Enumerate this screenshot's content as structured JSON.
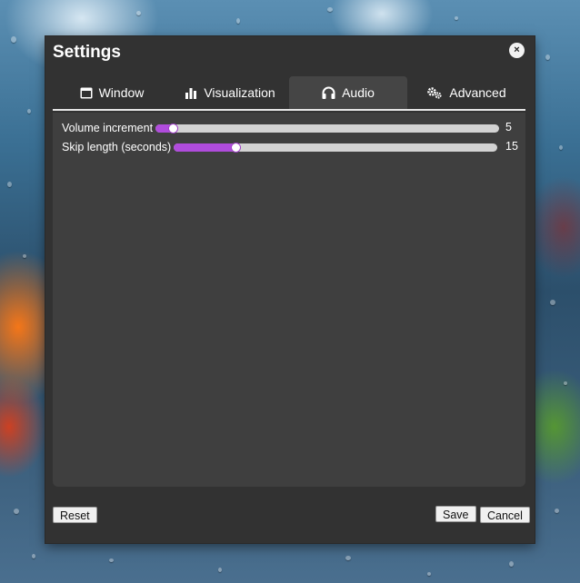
{
  "dialog": {
    "title": "Settings",
    "close_icon": "×"
  },
  "tabs": [
    {
      "label": "Window",
      "icon": "window-icon",
      "active": false
    },
    {
      "label": "Visualization",
      "icon": "bar-chart-icon",
      "active": false
    },
    {
      "label": "Audio",
      "icon": "headphones-icon",
      "active": true
    },
    {
      "label": "Advanced",
      "icon": "gears-icon",
      "active": false
    }
  ],
  "audio": {
    "volume_increment": {
      "label": "Volume increment",
      "value": "5",
      "fraction": 0.05
    },
    "skip_length": {
      "label": "Skip length (seconds)",
      "value": "15",
      "fraction": 0.19
    }
  },
  "footer": {
    "reset": "Reset",
    "save": "Save",
    "cancel": "Cancel"
  },
  "colors": {
    "accent": "#b04cdc",
    "dialog_bg": "#323232",
    "panel_bg": "#3f3f3f",
    "active_tab_bg": "#454545",
    "track": "#d3d3d3"
  }
}
